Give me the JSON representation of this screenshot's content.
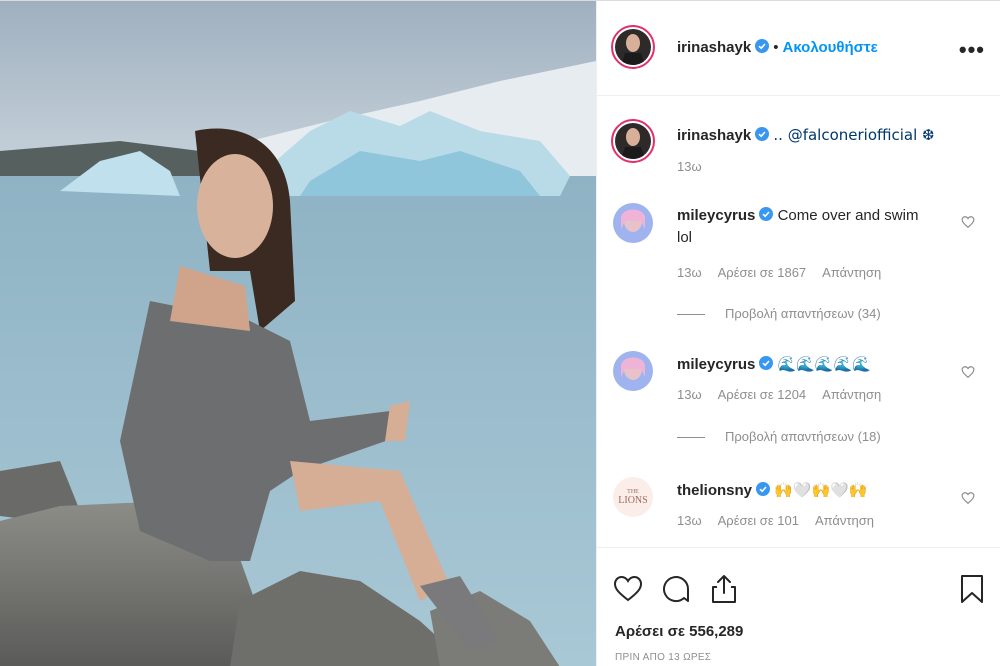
{
  "post": {
    "author": "irinashayk",
    "follow_label": "Ακολουθήστε",
    "more_icon_label": "•••"
  },
  "caption": {
    "username": "irinashayk",
    "text": ".. @falconeriofficial ❆",
    "time": "13ω"
  },
  "comments": [
    {
      "username": "mileycyrus",
      "text": "Come over and swim lol",
      "time": "13ω",
      "likes": "Αρέσει σε 1867",
      "reply": "Απάντηση",
      "view_replies": "Προβολή απαντήσεων (34)"
    },
    {
      "username": "mileycyrus",
      "text": "🌊🌊🌊🌊🌊",
      "time": "13ω",
      "likes": "Αρέσει σε 1204",
      "reply": "Απάντηση",
      "view_replies": "Προβολή απαντήσεων (18)"
    },
    {
      "username": "thelionsny",
      "text": "🙌🤍🙌🤍🙌",
      "time": "13ω",
      "likes": "Αρέσει σε 101",
      "reply": "Απάντηση"
    }
  ],
  "footer": {
    "likes": "Αρέσει σε 556,289",
    "posted": "ΠΡΙΝ ΑΠΟ 13 ΩΡΕΣ"
  },
  "colors": {
    "link": "#0095f6",
    "verified": "#3897f0",
    "muted": "#8e8e8e"
  },
  "icons": [
    "more-icon",
    "verified-icon",
    "heart-icon",
    "comment-icon",
    "share-icon",
    "bookmark-icon"
  ]
}
